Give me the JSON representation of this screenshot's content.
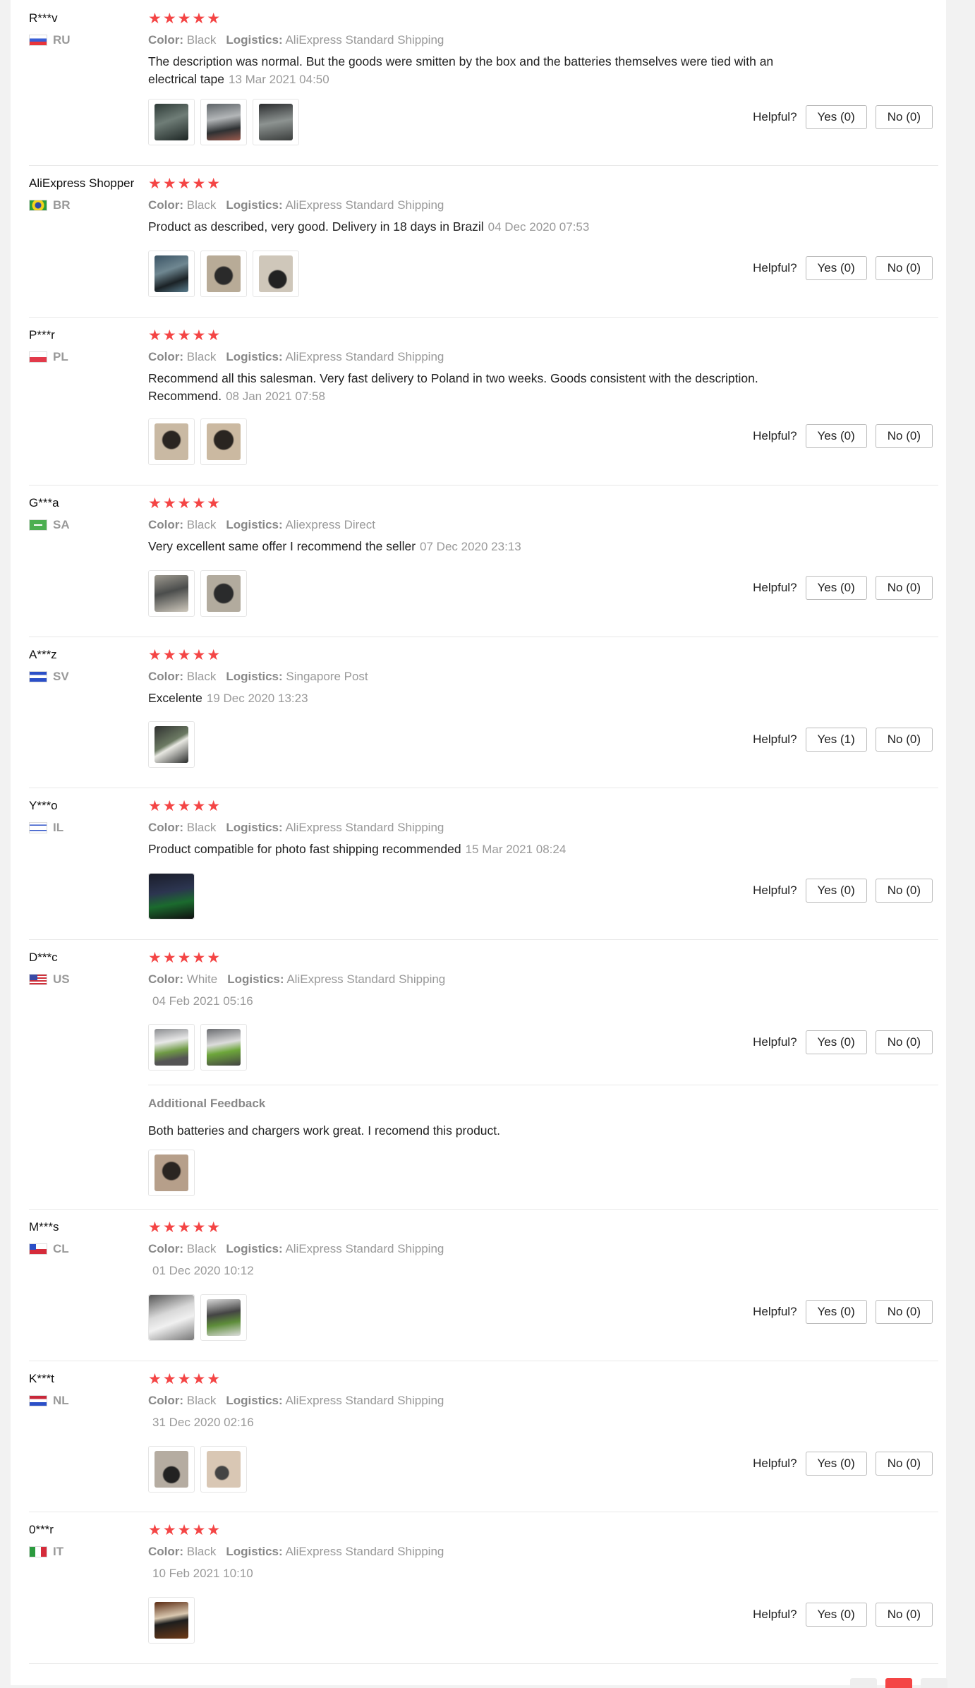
{
  "helpful_label": "Helpful?",
  "stars": "★★★★★",
  "reviews": [
    {
      "user": "R***v",
      "country": "RU",
      "color_label": "Color:",
      "color": "Black",
      "logistics_label": "Logistics:",
      "logistics": "AliExpress Standard Shipping",
      "text": "The description was normal. But the goods were smitten by the box and the batteries themselves were tied with an electrical tape",
      "date": "13 Mar 2021 04:50",
      "yes": "Yes (0)",
      "no": "No (0)"
    },
    {
      "user": "AliExpress Shopper",
      "country": "BR",
      "color_label": "Color:",
      "color": "Black",
      "logistics_label": "Logistics:",
      "logistics": "AliExpress Standard Shipping",
      "text": "Product as described, very good. Delivery in 18 days in Brazil",
      "date": "04 Dec 2020 07:53",
      "yes": "Yes (0)",
      "no": "No (0)"
    },
    {
      "user": "P***r",
      "country": "PL",
      "color_label": "Color:",
      "color": "Black",
      "logistics_label": "Logistics:",
      "logistics": "AliExpress Standard Shipping",
      "text": "Recommend all this salesman. Very fast delivery to Poland in two weeks. Goods consistent with the description. Recommend.",
      "date": "08 Jan 2021 07:58",
      "yes": "Yes (0)",
      "no": "No (0)"
    },
    {
      "user": "G***a",
      "country": "SA",
      "color_label": "Color:",
      "color": "Black",
      "logistics_label": "Logistics:",
      "logistics": "Aliexpress Direct",
      "text": "Very excellent same offer I recommend the seller",
      "date": "07 Dec 2020 23:13",
      "yes": "Yes (0)",
      "no": "No (0)"
    },
    {
      "user": "A***z",
      "country": "SV",
      "color_label": "Color:",
      "color": "Black",
      "logistics_label": "Logistics:",
      "logistics": "Singapore Post",
      "text": "Excelente",
      "date": "19 Dec 2020 13:23",
      "yes": "Yes (1)",
      "no": "No (0)"
    },
    {
      "user": "Y***o",
      "country": "IL",
      "color_label": "Color:",
      "color": "Black",
      "logistics_label": "Logistics:",
      "logistics": "AliExpress Standard Shipping",
      "text": "Product compatible for photo fast shipping recommended",
      "date": "15 Mar 2021 08:24",
      "yes": "Yes (0)",
      "no": "No (0)"
    },
    {
      "user": "D***c",
      "country": "US",
      "color_label": "Color:",
      "color": "White",
      "logistics_label": "Logistics:",
      "logistics": "AliExpress Standard Shipping",
      "text": "",
      "date": "04 Feb 2021 05:16",
      "yes": "Yes (0)",
      "no": "No (0)",
      "additional_label": "Additional Feedback",
      "additional_text": "Both batteries and chargers work great. I recomend this product."
    },
    {
      "user": "M***s",
      "country": "CL",
      "color_label": "Color:",
      "color": "Black",
      "logistics_label": "Logistics:",
      "logistics": "AliExpress Standard Shipping",
      "text": "",
      "date": "01 Dec 2020 10:12",
      "yes": "Yes (0)",
      "no": "No (0)"
    },
    {
      "user": "K***t",
      "country": "NL",
      "color_label": "Color:",
      "color": "Black",
      "logistics_label": "Logistics:",
      "logistics": "AliExpress Standard Shipping",
      "text": "",
      "date": "31 Dec 2020 02:16",
      "yes": "Yes (0)",
      "no": "No (0)"
    },
    {
      "user": "0***r",
      "country": "IT",
      "color_label": "Color:",
      "color": "Black",
      "logistics_label": "Logistics:",
      "logistics": "AliExpress Standard Shipping",
      "text": "",
      "date": "10 Feb 2021 10:10",
      "yes": "Yes (0)",
      "no": "No (0)"
    }
  ],
  "colors": {
    "star": "#f44545",
    "accent_page": "#f44545",
    "muted_text": "#999999"
  }
}
